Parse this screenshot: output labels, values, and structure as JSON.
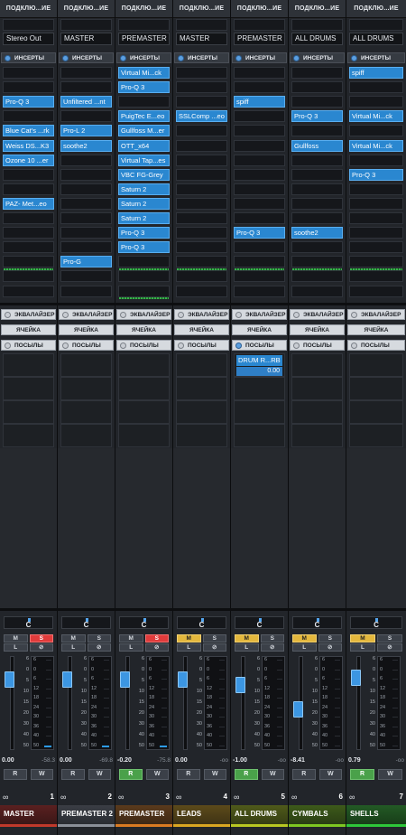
{
  "strips": [
    {
      "conn_header": "ПОДКЛЮ...ИЕ",
      "output": "Stereo Out",
      "inserts_label": "ИНСЕРТЫ",
      "inserts": [
        "",
        "",
        "Pro-Q 3",
        "",
        "Blue Cat's ...rk",
        "Weiss DS...K3",
        "Ozone 10 ...er",
        "",
        "",
        "PAZ- Met...eo",
        "",
        "",
        "",
        "",
        "",
        ""
      ],
      "eq_label": "ЭКВАЛАЙЗЕР",
      "cell_label": "ЯЧЕЙКА",
      "sends_label": "ПОСЫЛЫ",
      "pan": "C",
      "m": "M",
      "s": "S",
      "l": "L",
      "phase": "⊘",
      "volume": "0.00",
      "peak": "-58.3",
      "r": "R",
      "w": "W",
      "number": "1",
      "name": "MASTER"
    },
    {
      "conn_header": "ПОДКЛЮ...ИЕ",
      "output": "MASTER",
      "inserts_label": "ИНСЕРТЫ",
      "inserts": [
        "",
        "",
        "Unfiltered ...nt",
        "",
        "Pro-L 2",
        "soothe2",
        "",
        "",
        "",
        "",
        "",
        "",
        "",
        "Pro-G",
        "",
        ""
      ],
      "eq_label": "ЭКВАЛАЙЗЕР",
      "cell_label": "ЯЧЕЙКА",
      "sends_label": "ПОСЫЛЫ",
      "pan": "C",
      "m": "M",
      "s": "S",
      "l": "L",
      "phase": "⊘",
      "volume": "0.00",
      "peak": "-69.8",
      "r": "R",
      "w": "W",
      "number": "2",
      "name": "PREMASTER 2"
    },
    {
      "conn_header": "ПОДКЛЮ...ИЕ",
      "output": "PREMASTER 2",
      "inserts_label": "ИНСЕРТЫ",
      "inserts": [
        "Virtual Mi...ck",
        "Pro-Q 3",
        "",
        "PuigTec E...eo",
        "Gullfoss M...er",
        "OTT_x64",
        "Virtual Tap...es",
        "VBC FG-Grey",
        "Saturn 2",
        "Saturn 2",
        "Saturn 2",
        "Pro-Q 3",
        "Pro-Q 3",
        "",
        "",
        ""
      ],
      "eq_label": "ЭКВАЛАЙЗЕР",
      "cell_label": "ЯЧЕЙКА",
      "sends_label": "ПОСЫЛЫ",
      "pan": "C",
      "m": "M",
      "s": "S",
      "l": "L",
      "phase": "⊘",
      "volume": "-0.20",
      "peak": "-75.8",
      "r": "R",
      "w": "W",
      "number": "3",
      "name": "PREMASTER"
    },
    {
      "conn_header": "ПОДКЛЮ...ИЕ",
      "output": "MASTER",
      "inserts_label": "ИНСЕРТЫ",
      "inserts": [
        "",
        "",
        "",
        "SSLComp ...eo",
        "",
        "",
        "",
        "",
        "",
        "",
        "",
        "",
        "",
        "",
        "",
        ""
      ],
      "eq_label": "ЭКВАЛАЙЗЕР",
      "cell_label": "ЯЧЕЙКА",
      "sends_label": "ПОСЫЛЫ",
      "pan": "C",
      "m": "M",
      "s": "S",
      "l": "L",
      "phase": "⊘",
      "volume": "0.00",
      "peak": "-oo",
      "r": "R",
      "w": "W",
      "number": "4",
      "name": "LEADS"
    },
    {
      "conn_header": "ПОДКЛЮ...ИЕ",
      "output": "PREMASTER",
      "inserts_label": "ИНСЕРТЫ",
      "inserts": [
        "",
        "",
        "spiff",
        "",
        "",
        "",
        "",
        "",
        "",
        "",
        "",
        "Pro-Q 3",
        "",
        "",
        "",
        ""
      ],
      "eq_label": "ЭКВАЛАЙЗЕР",
      "cell_label": "ЯЧЕЙКА",
      "sends_label": "ПОСЫЛЫ",
      "send_name": "DRUM R...RB",
      "send_value": "0.00",
      "pan": "C",
      "m": "M",
      "s": "S",
      "l": "L",
      "phase": "⊘",
      "volume": "-1.00",
      "peak": "-oo",
      "r": "R",
      "w": "W",
      "number": "5",
      "name": "ALL DRUMS"
    },
    {
      "conn_header": "ПОДКЛЮ...ИЕ",
      "output": "ALL DRUMS",
      "inserts_label": "ИНСЕРТЫ",
      "inserts": [
        "",
        "",
        "",
        "Pro-Q 3",
        "",
        "Gullfoss",
        "",
        "",
        "",
        "",
        "",
        "soothe2",
        "",
        "",
        "",
        ""
      ],
      "eq_label": "ЭКВАЛАЙЗЕР",
      "cell_label": "ЯЧЕЙКА",
      "sends_label": "ПОСЫЛЫ",
      "pan": "C",
      "m": "M",
      "s": "S",
      "l": "L",
      "phase": "⊘",
      "volume": "-8.41",
      "peak": "-oo",
      "r": "R",
      "w": "W",
      "number": "6",
      "name": "CYMBALS"
    },
    {
      "conn_header": "ПОДКЛЮ...ИЕ",
      "output": "ALL DRUMS",
      "inserts_label": "ИНСЕРТЫ",
      "inserts": [
        "spiff",
        "",
        "",
        "Virtual Mi...ck",
        "",
        "Virtual Mi...ck",
        "",
        "Pro-Q 3",
        "",
        "",
        "",
        "",
        "",
        "",
        "",
        ""
      ],
      "eq_label": "ЭКВАЛАЙЗЕР",
      "cell_label": "ЯЧЕЙКА",
      "sends_label": "ПОСЫЛЫ",
      "pan": "C",
      "m": "M",
      "s": "S",
      "l": "L",
      "phase": "⊘",
      "volume": "0.79",
      "peak": "-oo",
      "r": "R",
      "w": "W",
      "number": "7",
      "name": "SHELLS"
    }
  ],
  "state": {
    "mute_on": [
      false,
      false,
      false,
      true,
      true,
      true,
      true
    ],
    "solo_on": [
      true,
      false,
      true,
      false,
      false,
      false,
      false
    ],
    "read_on": [
      false,
      false,
      true,
      false,
      true,
      false,
      true
    ],
    "fader_level": [
      0.84,
      0.84,
      0.84,
      0.84,
      0.78,
      0.52,
      0.86
    ]
  },
  "scale_ticks": [
    "6",
    "0",
    "5",
    "10",
    "15",
    "20",
    "30",
    "40",
    "50"
  ],
  "meter_ticks": [
    "6",
    "0",
    "6",
    "12",
    "18",
    "24",
    "30",
    "36",
    "40",
    "50"
  ],
  "link_icon": "link-rings-icon",
  "colors": {
    "insert_on": "#2a87d0",
    "mute": "#e3b73d",
    "solo": "#e03b3b",
    "read": "#4aa14a",
    "track_colors": [
      "#c0392b",
      "#8a8f98",
      "#d97a22",
      "#d9a622",
      "#b8c722",
      "#7ec722",
      "#2ec73a"
    ]
  }
}
